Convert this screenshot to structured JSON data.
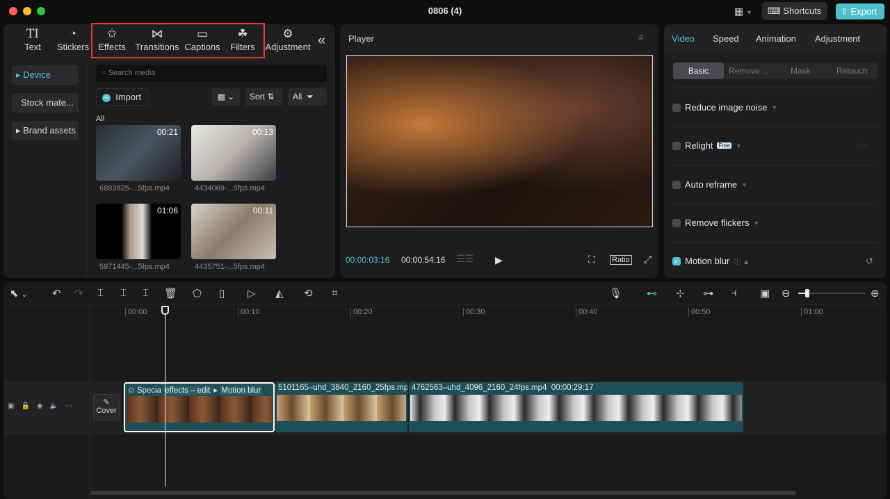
{
  "window": {
    "title": "0806 (4)",
    "shortcuts_label": "Shortcuts",
    "export_label": "Export"
  },
  "toolbar": {
    "items": [
      {
        "label": "Text",
        "icon": "TI"
      },
      {
        "label": "Stickers",
        "icon": "◔"
      },
      {
        "label": "Effects",
        "icon": "✩"
      },
      {
        "label": "Transitions",
        "icon": "⋈"
      },
      {
        "label": "Captions",
        "icon": "▭"
      },
      {
        "label": "Filters",
        "icon": "☘"
      },
      {
        "label": "Adjustment",
        "icon": "⚙"
      }
    ],
    "collapse_icon": "«"
  },
  "sidebar": {
    "items": [
      {
        "label": "Device"
      },
      {
        "label": "Stock mate..."
      },
      {
        "label": "Brand assets"
      }
    ]
  },
  "media": {
    "search_placeholder": "Search media",
    "import_label": "Import",
    "sort_label": "Sort",
    "filter_label": "All",
    "section_label": "All",
    "items": [
      {
        "name": "6883825-...5fps.mp4",
        "duration": "00:21"
      },
      {
        "name": "4434069-...5fps.mp4",
        "duration": "00:13"
      },
      {
        "name": "5971445-...5fps.mp4",
        "duration": "01:06"
      },
      {
        "name": "4435751-...5fps.mp4",
        "duration": "00:11"
      }
    ]
  },
  "player": {
    "title": "Player",
    "current_time": "00:00:03:16",
    "total_time": "00:00:54:16",
    "ratio_label": "Ratio"
  },
  "inspector": {
    "tabs": [
      "Video",
      "Speed",
      "Animation",
      "Adjustment"
    ],
    "subtabs": [
      "Basic",
      "Remove ...",
      "Mask",
      "Retouch"
    ],
    "options": [
      {
        "label": "Reduce image noise",
        "checked": false
      },
      {
        "label": "Relight",
        "checked": false,
        "badge": "Free"
      },
      {
        "label": "Auto reframe",
        "checked": false
      },
      {
        "label": "Remove flickers",
        "checked": false
      },
      {
        "label": "Motion blur",
        "checked": true
      }
    ]
  },
  "timeline": {
    "ticks": [
      "00:00",
      "00:10",
      "00:20",
      "00:30",
      "00:40",
      "00:50",
      "01:00"
    ],
    "cover_label": "Cover",
    "clips": [
      {
        "label": "Specia",
        "effect1": "effects – edit",
        "effect2": "Motion blur"
      },
      {
        "label": "5101165–uhd_3840_2160_25fps.mp4"
      },
      {
        "label": "4762563–uhd_4096_2160_24fps.mp4",
        "duration": "00:00:29:17"
      }
    ]
  },
  "colors": {
    "accent": "#4fc3d0",
    "clip": "#1f4f56",
    "highlight_box": "#e0402a"
  }
}
